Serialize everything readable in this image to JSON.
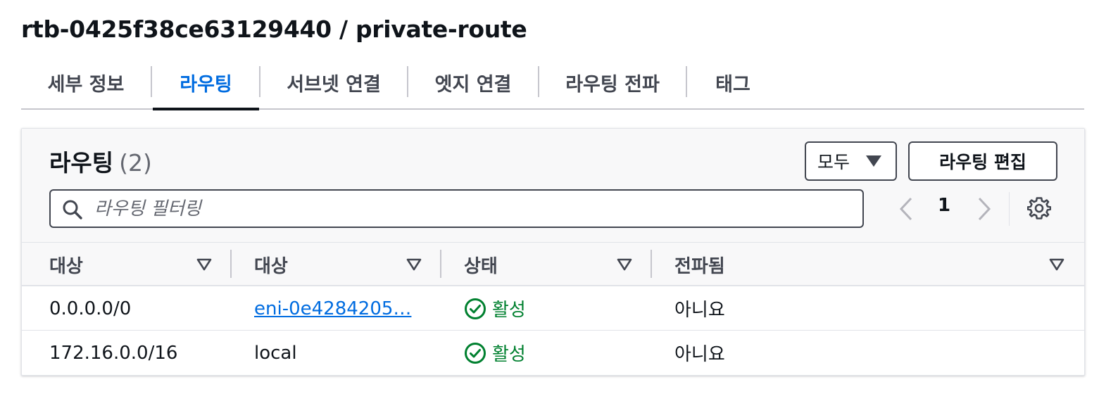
{
  "page": {
    "title": "rtb-0425f38ce63129440 / private-route"
  },
  "tabs": [
    {
      "label": "세부 정보",
      "active": false
    },
    {
      "label": "라우팅",
      "active": true
    },
    {
      "label": "서브넷 연결",
      "active": false
    },
    {
      "label": "엣지 연결",
      "active": false
    },
    {
      "label": "라우팅 전파",
      "active": false
    },
    {
      "label": "태그",
      "active": false
    }
  ],
  "routes_panel": {
    "title": "라우팅",
    "count": "(2)",
    "filter_select": "모두",
    "edit_button": "라우팅 편집",
    "search_placeholder": "라우팅 필터링",
    "current_page": "1"
  },
  "table": {
    "columns": [
      "대상",
      "대상",
      "상태",
      "전파됨"
    ],
    "rows": [
      {
        "destination": "0.0.0.0/0",
        "target": "eni-0e4284205…",
        "target_is_link": true,
        "status": "활성",
        "propagated": "아니요"
      },
      {
        "destination": "172.16.0.0/16",
        "target": "local",
        "target_is_link": false,
        "status": "활성",
        "propagated": "아니요"
      }
    ]
  },
  "colors": {
    "accent": "#006ce0",
    "success": "#00802f",
    "text": "#0f141a",
    "muted": "#424650"
  },
  "icons": {
    "search": "search-icon",
    "prev": "chevron-left-icon",
    "next": "chevron-right-icon",
    "settings": "gear-icon",
    "sort": "sort-down-icon",
    "status": "check-circle-icon",
    "dropdown": "caret-down-icon"
  }
}
